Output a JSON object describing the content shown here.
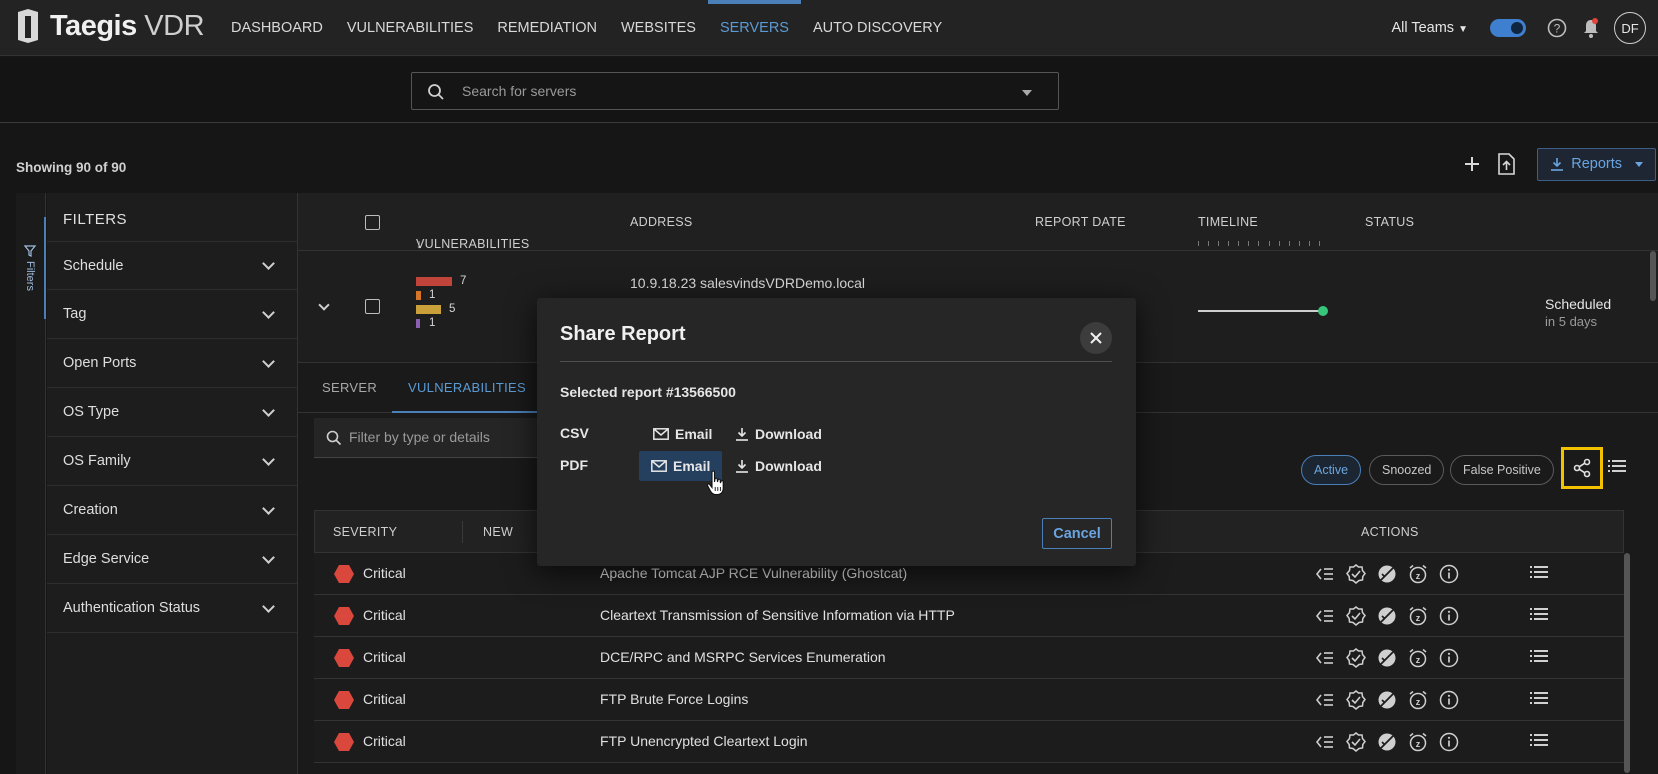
{
  "header": {
    "brand": "Taegis",
    "product": "VDR",
    "nav": [
      "DASHBOARD",
      "VULNERABILITIES",
      "REMEDIATION",
      "WEBSITES",
      "SERVERS",
      "AUTO DISCOVERY"
    ],
    "active_nav": "SERVERS",
    "teams": "All Teams",
    "avatar_initials": "DF"
  },
  "search": {
    "placeholder": "Search for servers"
  },
  "toolbar": {
    "showing": "Showing 90 of 90",
    "reports_label": "Reports"
  },
  "sidebar": {
    "tab_label": "Filters",
    "title": "FILTERS",
    "items": [
      "Schedule",
      "Tag",
      "Open Ports",
      "OS Type",
      "OS Family",
      "Creation",
      "Edge Service",
      "Authentication Status"
    ]
  },
  "table": {
    "columns": [
      "VULNERABILITIES",
      "ADDRESS",
      "REPORT DATE",
      "TIMELINE",
      "STATUS"
    ],
    "server_row": {
      "address": "10.9.18.23 salesvindsVDRDemo.local",
      "vuln_counts": [
        {
          "count": "7",
          "color": "#c0443a"
        },
        {
          "count": "1",
          "color": "#d5752a"
        },
        {
          "count": "5",
          "color": "#c9a03a"
        },
        {
          "count": "1",
          "color": "#8d5fb0"
        }
      ],
      "status": "Scheduled",
      "status_sub": "in 5 days"
    }
  },
  "detail": {
    "tabs": [
      "SERVER",
      "VULNERABILITIES"
    ],
    "active_tab": "VULNERABILITIES",
    "filter_placeholder": "Filter by type or details",
    "chips": [
      "Active",
      "Snoozed",
      "False Positive"
    ],
    "columns": [
      "SEVERITY",
      "NEW",
      "ACTIONS"
    ],
    "rows": [
      {
        "severity": "Critical",
        "name": "Apache Tomcat AJP RCE Vulnerability (Ghostcat)"
      },
      {
        "severity": "Critical",
        "name": "Cleartext Transmission of Sensitive Information via HTTP"
      },
      {
        "severity": "Critical",
        "name": "DCE/RPC and MSRPC Services Enumeration"
      },
      {
        "severity": "Critical",
        "name": "FTP Brute Force Logins"
      },
      {
        "severity": "Critical",
        "name": "FTP Unencrypted Cleartext Login"
      }
    ]
  },
  "modal": {
    "title": "Share Report",
    "selected": "Selected report #13566500",
    "csv_label": "CSV",
    "pdf_label": "PDF",
    "email_label": "Email",
    "download_label": "Download",
    "cancel_label": "Cancel"
  },
  "colors": {
    "accent": "#5b9bd5",
    "critical": "#d9473d",
    "highlight": "#f2c200",
    "timeline_dot": "#38c77a"
  }
}
